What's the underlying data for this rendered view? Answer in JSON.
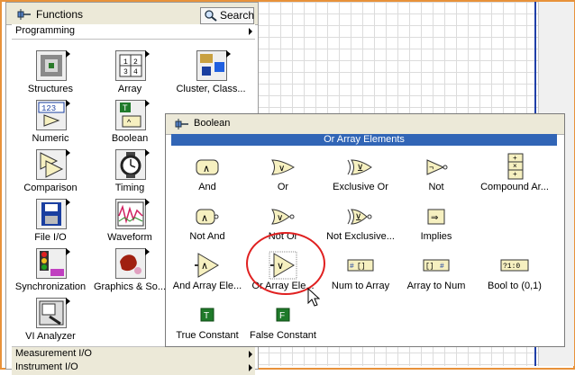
{
  "functions_palette": {
    "title": "Functions",
    "search_label": "Search",
    "category": "Programming",
    "items": [
      {
        "label": "Structures",
        "icon": "structures-icon"
      },
      {
        "label": "Array",
        "icon": "array-icon"
      },
      {
        "label": "Cluster, Class...",
        "icon": "cluster-class-icon"
      },
      {
        "label": "Numeric",
        "icon": "numeric-icon"
      },
      {
        "label": "Boolean",
        "icon": "boolean-icon"
      },
      {
        "label": "Comparison",
        "icon": "comparison-icon"
      },
      {
        "label": "Timing",
        "icon": "timing-icon"
      },
      {
        "label": "File I/O",
        "icon": "file-io-icon"
      },
      {
        "label": "Waveform",
        "icon": "waveform-icon"
      },
      {
        "label": "Synchronization",
        "icon": "synchronization-icon"
      },
      {
        "label": "Graphics & So...",
        "icon": "graphics-sound-icon"
      },
      {
        "label": "VI Analyzer",
        "icon": "vi-analyzer-icon"
      }
    ],
    "bottom_categories": [
      "Measurement I/O",
      "Instrument I/O"
    ]
  },
  "boolean_palette": {
    "title": "Boolean",
    "highlight": "Or Array Elements",
    "items": [
      {
        "label": "And",
        "glyph": "∧"
      },
      {
        "label": "Or",
        "glyph": "∨"
      },
      {
        "label": "Exclusive Or",
        "glyph": "⊻"
      },
      {
        "label": "Not",
        "glyph": "¬"
      },
      {
        "label": "Compound Ar...",
        "glyph": "+"
      },
      {
        "label": "Not And",
        "glyph": "∧"
      },
      {
        "label": "Not Or",
        "glyph": "∨"
      },
      {
        "label": "Not Exclusive...",
        "glyph": "⊻"
      },
      {
        "label": "Implies",
        "glyph": "⇒"
      },
      {
        "label": "And Array Ele...",
        "glyph": "∧"
      },
      {
        "label": "Or Array Ele...",
        "glyph": "∨"
      },
      {
        "label": "Num to Array",
        "glyph": "#"
      },
      {
        "label": "Array to Num",
        "glyph": "#"
      },
      {
        "label": "Bool to (0,1)",
        "glyph": "?1:0"
      },
      {
        "label": "True Constant",
        "glyph": "T"
      },
      {
        "label": "False Constant",
        "glyph": "F"
      }
    ]
  },
  "colors": {
    "accent": "#3165b6",
    "frame": "#e8923a",
    "highlight_circle": "#e02020"
  }
}
